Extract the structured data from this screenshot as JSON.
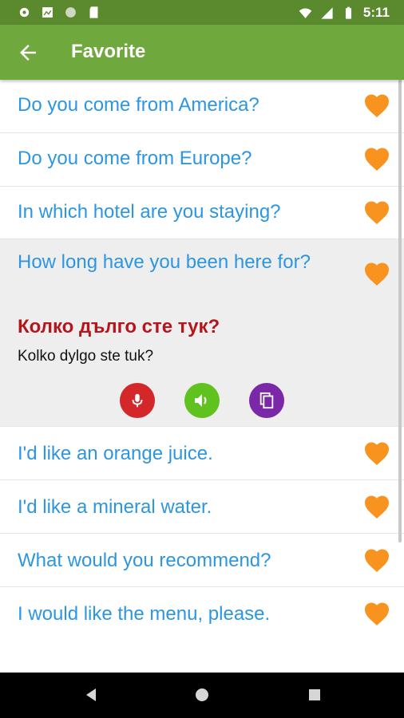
{
  "status_bar": {
    "time": "5:11",
    "icons": [
      "settings-icon",
      "image-icon",
      "circle-icon",
      "sd-card-icon",
      "wifi-icon",
      "signal-icon",
      "battery-icon"
    ]
  },
  "app_bar": {
    "title": "Favorite",
    "back_icon": "arrow-back-icon",
    "color": "#6fa83c"
  },
  "phrases": [
    {
      "text": "Do you come from America?",
      "favorite": true
    },
    {
      "text": "Do you come from Europe?",
      "favorite": true
    },
    {
      "text": "In which hotel are you staying?",
      "favorite": true
    }
  ],
  "expanded_item": {
    "text": "How long have you been here for?",
    "translation": "Колко дълго сте тук?",
    "transliteration": "Kolko dylgo ste tuk?",
    "favorite": true,
    "actions": [
      {
        "icon": "microphone-icon",
        "color": "#d3272a"
      },
      {
        "icon": "speaker-icon",
        "color": "#5fc21f"
      },
      {
        "icon": "copy-icon",
        "color": "#7a27a8"
      }
    ]
  },
  "phrases_after": [
    {
      "text": "I'd like an orange juice.",
      "favorite": true
    },
    {
      "text": "I'd like a mineral water.",
      "favorite": true
    },
    {
      "text": "What would you recommend?",
      "favorite": true
    },
    {
      "text": "I would like the menu, please.",
      "favorite": true
    }
  ],
  "colors": {
    "phrase_text": "#2c96e0",
    "heart": "#f7931e",
    "translation_text": "#b3161d"
  },
  "nav_bar": {
    "buttons": [
      "back-triangle-icon",
      "home-circle-icon",
      "recents-square-icon"
    ]
  }
}
